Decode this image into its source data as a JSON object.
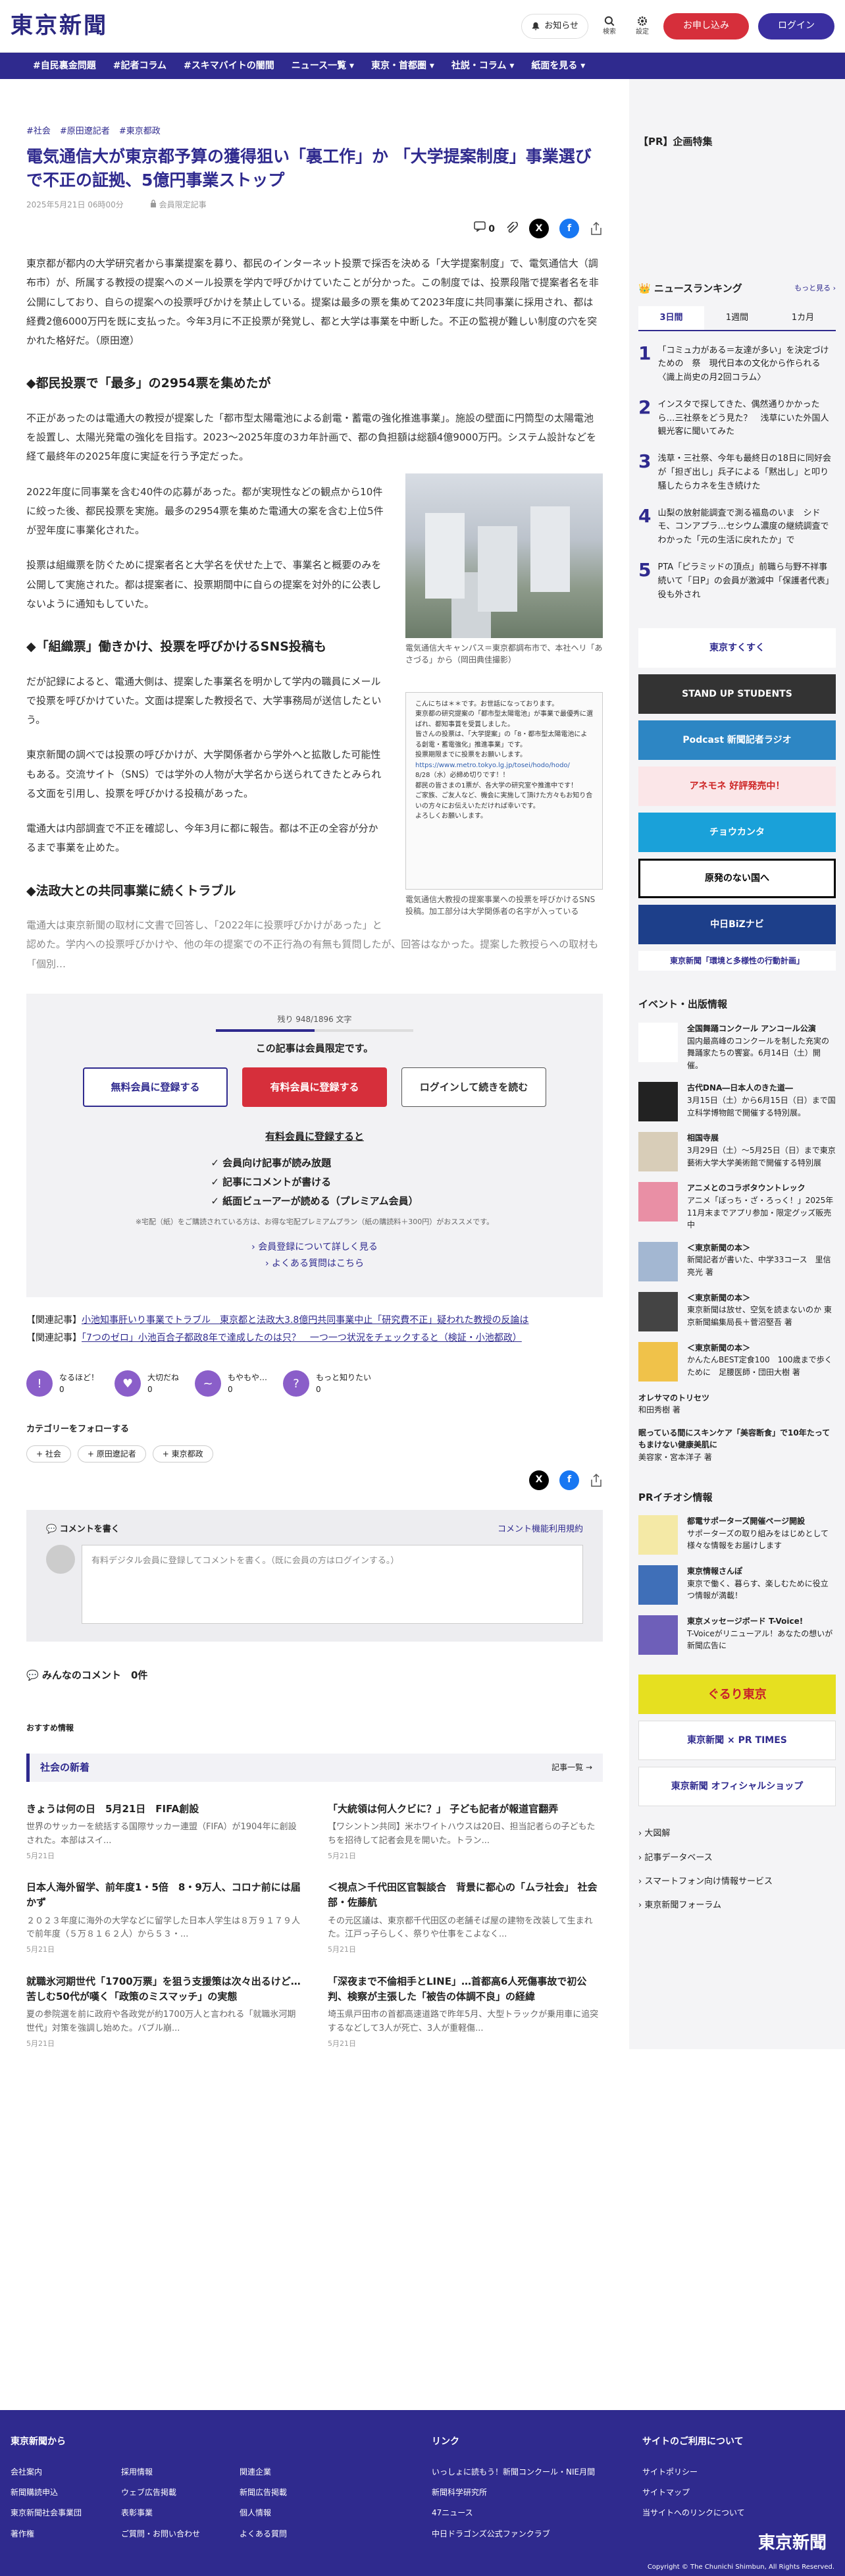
{
  "header": {
    "logo": "東京新聞",
    "notify": "お知らせ",
    "search": "検索",
    "settings": "設定",
    "register": "お申し込み",
    "login": "ログイン"
  },
  "nav": [
    "#自民裏金問題",
    "#記者コラム",
    "#スキマバイトの闇間",
    "ニュース一覧 ▾",
    "東京・首都圏 ▾",
    "社説・コラム ▾",
    "紙面を見る ▾"
  ],
  "article": {
    "tags": [
      "#社会",
      "#原田遼記者",
      "#東京都政"
    ],
    "title": "電気通信大が東京都予算の獲得狙い「裏工作」か 「大学提案制度」事業選びで不正の証拠、5億円事業ストップ",
    "date": "2025年5月21日 06時00分",
    "member_only": "会員限定記事",
    "comment_count": "0",
    "p1": "東京都が都内の大学研究者から事業提案を募り、都民のインターネット投票で採否を決める「大学提案制度」で、電気通信大（調布市）が、所属する教授の提案へのメール投票を学内で呼びかけていたことが分かった。この制度では、投票段階で提案者名を非公開にしており、自らの提案への投票呼びかけを禁止している。提案は最多の票を集めて2023年度に共同事業に採用され、都は経費2億6000万円を既に支払った。今年3月に不正投票が発覚し、都と大学は事業を中断した。不正の監視が難しい制度の穴を突かれた格好だ。（原田遼）",
    "h1": "◆都民投票で「最多」の2954票を集めたが",
    "p2": "不正があったのは電通大の教授が提案した「都市型太陽電池による創電・蓄電の強化推進事業」。施設の壁面に円筒型の太陽電池を設置し、太陽光発電の強化を目指す。2023〜2025年度の3カ年計画で、都の負担額は総額4億9000万円。システム設計などを経て最終年の2025年度に実証を行う予定だった。",
    "p3": "2022年度に同事業を含む40件の応募があった。都が実現性などの観点から10件に絞った後、都民投票を実施。最多の2954票を集めた電通大の案を含む上位5件が翌年度に事業化された。",
    "p4": "投票は組織票を防ぐために提案者名と大学名を伏せた上で、事業名と概要のみを公開して実施された。都は提案者に、投票期間中に自らの提案を対外的に公表しないように通知もしていた。",
    "h2": "◆「組織票」働きかけ、投票を呼びかけるSNS投稿も",
    "p5": "だが記録によると、電通大側は、提案した事業名を明かして学内の職員にメールで投票を呼びかけていた。文面は提案した教授名で、大学事務局が送信したという。",
    "p6": "東京新聞の調べでは投票の呼びかけが、大学関係者から学外へと拡散した可能性もある。交流サイト（SNS）では学外の人物が大学名から送られてきたとみられる文面を引用し、投票を呼びかける投稿があった。",
    "p7": "電通大は内部調査で不正を確認し、今年3月に都に報告。都は不正の全容が分かるまで事業を止めた。",
    "h3": "◆法政大との共同事業に続くトラブル",
    "p8": "電通大は東京新聞の取材に文書で回答し、「2022年に投票呼びかけがあった」と認めた。学内への投票呼びかけや、他の年の提案での不正行為の有無も質問したが、回答はなかった。提案した教授らへの取材も「個別…",
    "fig1_caption": "電気通信大キャンパス＝東京都調布市で、本社ヘリ「あさづる」から（岡田典佳撮影）",
    "fig2_caption": "電気通信大教授の提案事業への投票を呼びかけるSNS投稿。加工部分は大学関係者の名字が入っている",
    "doc_lines": [
      "こんにちは＊＊です。お世話になっております。",
      "東京都の研究提案の「都市型太陽電池」が事業で最優秀に選ばれ、都知事賞を受賞しました。",
      "皆さんの投票は、「大学提案」の「8・都市型太陽電池による創電・蓄電強化」推進事業」です。",
      "投票期限までに投票をお願いします。",
      "https://www.metro.tokyo.lg.jp/tosei/hodo/hodo/",
      "8/28（水）必締め切りです！！",
      "都民の皆さまの1票が、各大学の研究室や推進中です！",
      "ご家族、ご友人など、機会に実施して頂けた方々もお知り合いの方々にお伝えいただければ幸いです。",
      "よろしくお願いします。"
    ]
  },
  "paywall": {
    "progress": "残り 948/1896 文字",
    "notice": "この記事は会員限定です。",
    "free": "無料会員に登録する",
    "paid": "有料会員に登録する",
    "login": "ログインして続きを読む",
    "benefits_title": "有料会員に登録すると",
    "benefits": [
      "会員向け記事が読み放題",
      "記事にコメントが書ける",
      "紙面ビューアーが読める（プレミアム会員）"
    ],
    "note": "※宅配（紙）をご購読されている方は、お得な宅配プレミアムプラン（紙の購読料＋300円）がおススメです。",
    "link1": "会員登録について詳しく見る",
    "link2": "よくある質問はこちら"
  },
  "related": [
    {
      "label": "【関連記事】",
      "text": "小池知事肝いり事業でトラブル　東京都と法政大3.8億円共同事業中止「研究費不正」疑われた教授の反論は"
    },
    {
      "label": "【関連記事】",
      "text": "「7つのゼロ」小池百合子都政8年で達成したのは只？　一つ一つ状況をチェックすると（検証・小池都政）"
    }
  ],
  "reactions": [
    {
      "label": "なるほど！",
      "count": "0"
    },
    {
      "label": "大切だね",
      "count": "0"
    },
    {
      "label": "もやもや…",
      "count": "0"
    },
    {
      "label": "もっと知りたい",
      "count": "0"
    }
  ],
  "follow": {
    "title": "カテゴリーをフォローする",
    "tags": [
      "+ 社会",
      "+ 原田遼記者",
      "+ 東京都政"
    ]
  },
  "comment": {
    "title": "コメントを書く",
    "rules": "コメント機能利用規約",
    "placeholder": "有料デジタル会員に登録してコメントを書く。（既に会員の方はログインする。）",
    "all_title": "みんなのコメント",
    "all_count": "0件"
  },
  "recommend": {
    "title": "おすすめ情報",
    "section": "社会の新着",
    "more": "記事一覧 →"
  },
  "news": [
    {
      "title": "きょうは何の日　5月21日　FIFA創設",
      "body": "世界のサッカーを統括する国際サッカー連盟（FIFA）が1904年に創設された。本部はスイ...",
      "date": "5月21日"
    },
    {
      "title": "「大統領は何人クビに？」 子ども記者が報道官翻弄",
      "body": "【ワシントン共同】米ホワイトハウスは20日、担当記者らの子どもたちを招待して記者会見を開いた。トラン...",
      "date": "5月21日"
    },
    {
      "title": "日本人海外留学、前年度1・5倍　8・9万人、コロナ前には届かず",
      "body": "２０２３年度に海外の大学などに留学した日本人学生は８万９１７９人で前年度（５万８１６２人）から５３・...",
      "date": "5月21日"
    },
    {
      "title": "＜視点＞千代田区官製談合　背景に都心の「ムラ社会」 社会部・佐藤航",
      "body": "その元区議は、東京都千代田区の老舗そば屋の建物を改装して生まれた。江戸っ子らしく、祭りや仕事をこよなく...",
      "date": "5月21日"
    },
    {
      "title": "就職氷河期世代「1700万票」を狙う支援策は次々出るけど…苦しむ50代が嘆く「政策のミスマッチ」の実態",
      "body": "夏の参院選を前に政府や各政党が約1700万人と言われる「就職氷河期世代」対策を強調し始めた。バブル崩...",
      "date": "5月21日"
    },
    {
      "title": "「深夜まで不倫相手とLINE」…首都高6人死傷事故で初公判、検察が主張した「被告の体調不良」の経緯",
      "body": "埼玉県戸田市の首都高速道路で昨年5月、大型トラックが乗用車に追突するなどして3人が死亡、3人が重軽傷...",
      "date": "5月21日"
    }
  ],
  "sidebar": {
    "pr_title": "【PR】企画特集",
    "ranking_title": "ニュースランキング",
    "ranking_more": "もっと見る ›",
    "tabs": [
      "3日間",
      "1週間",
      "1カ月"
    ],
    "ranking": [
      {
        "n": "1",
        "t": "「コミュ力がある＝友達が多い」を決定づけための　祭　現代日本の文化から作られる〈識上尚史の月2回コラム〉"
      },
      {
        "n": "2",
        "t": "インスタで探してきた、偶然通りかかったら…三社祭をどう見た？　浅草にいた外国人観光客に聞いてみた"
      },
      {
        "n": "3",
        "t": "浅草・三社祭、今年も最終日の18日に同好会が「担ぎ出し」兵子による「黙出し」と叩り騒したらカネを生き続けた"
      },
      {
        "n": "4",
        "t": "山梨の放射能調査で測る福島のいま　シドモ、コンアプラ…セシウム濃度の継続調査でわかった「元の生活に戻れたか」で"
      },
      {
        "n": "5",
        "t": "PTA「ピラミッドの頂点」前職ら与野不祥事続いて「日P」の会員が激減中「保護者代表」役も外され"
      }
    ],
    "banners": [
      "東京すくすく",
      "STAND UP STUDENTS",
      "Podcast 新聞記者ラジオ",
      "アネモネ 好評発売中！",
      "チョウカンタ",
      "原発のない国へ",
      "中日BiZナビ",
      "東京新聞「環境と多様性の行動計画」"
    ],
    "events_title": "イベント・出版情報",
    "events": [
      {
        "t": "全国舞踊コンクール アンコール公演",
        "d": "国内最高峰のコンクールを制した充実の舞踊家たちの饗宴。6月14日（土）開催。"
      },
      {
        "t": "古代DNA―日本人のきた道―",
        "d": "3月15日（土）から6月15日（日）まで国立科学博物館で開催する特別展。"
      },
      {
        "t": "相国寺展",
        "d": "3月29日（土）〜5月25日（日）まで東京藝術大学大学美術館で開催する特別展"
      },
      {
        "t": "アニメとのコラボタウントレック",
        "d": "アニメ「ぼっち・ざ・ろっく！」2025年11月末までアプリ参加・限定グッズ販売中"
      },
      {
        "t": "＜東京新聞の本＞",
        "d": "新聞記者が書いた、中学33コース　里信亮光 著"
      },
      {
        "t": "＜東京新聞の本＞",
        "d": "東京新聞は放せ、空気を読まないのか 東京新聞編集局長＋菅沼堅吾 著"
      },
      {
        "t": "＜東京新聞の本＞",
        "d": "かんたんBEST定食100　100歳まで歩くために　足腰医師・団田大樹 著"
      },
      {
        "t": "オレサマのトリセツ",
        "d": "和田秀樹 著"
      },
      {
        "t": "眠っている間にスキンケア「美容断食」で10年たってもまけない健康美肌に",
        "d": "美容家・宮本洋子 著"
      }
    ],
    "pr_info_title": "PRイチオシ情報",
    "pr": [
      {
        "t": "都電サポーターズ開催ページ開設",
        "d": "サポーターズの取り組みをはじめとして様々な情報をお届けします"
      },
      {
        "t": "東京情報さんぽ",
        "d": "東京で働く、暮らす、楽しむために役立つ情報が満載！"
      },
      {
        "t": "東京メッセージボード T-Voice!",
        "d": "T-Voiceがリニューアル！あなたの想いが新聞広告に"
      }
    ],
    "shop": [
      "ぐるり東京",
      "東京新聞 × PR TIMES",
      "東京新聞 オフィシャルショップ"
    ],
    "links": [
      "大図解",
      "記事データベース",
      "スマートフォン向け情報サービス",
      "東京新聞フォーラム"
    ]
  },
  "footer": {
    "col1_title": "東京新聞から",
    "col1": [
      "会社案内",
      "新聞購読申込",
      "東京新聞社会事業団",
      "著作権"
    ],
    "col2": [
      "採用情報",
      "ウェブ広告掲載",
      "表彰事業",
      "ご質問・お問い合わせ"
    ],
    "col3": [
      "関連企業",
      "新聞広告掲載",
      "個人情報",
      "よくある質問"
    ],
    "col4_title": "リンク",
    "col4": [
      "いっしょに読もう！新聞コンクール・NIE月間",
      "新聞科学研究所",
      "47ニュース",
      "中日ドラゴンズ公式ファンクラブ"
    ],
    "col5_title": "サイトのご利用について",
    "col5": [
      "サイトポリシー",
      "サイトマップ",
      "当サイトへのリンクについて"
    ],
    "logo": "東京新聞",
    "copyright": "Copyright © The Chunichi Shimbun, All Rights Reserved."
  }
}
